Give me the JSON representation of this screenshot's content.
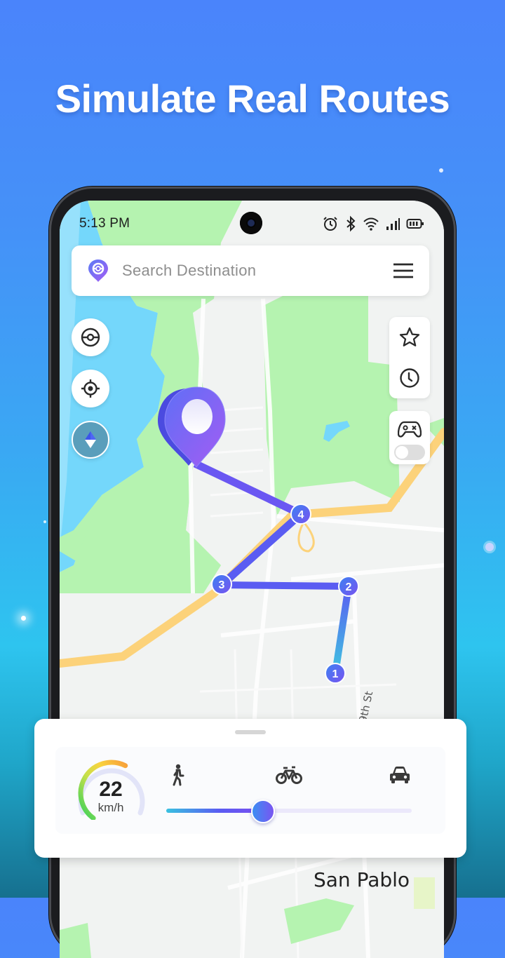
{
  "headline": "Simulate Real Routes",
  "status_bar": {
    "time": "5:13 PM",
    "icons": [
      "alarm-icon",
      "bluetooth-icon",
      "wifi-icon",
      "signal-icon",
      "battery-icon"
    ]
  },
  "search": {
    "placeholder": "Search Destination",
    "leading_icon": "location-pin-icon",
    "menu_icon": "hamburger-menu-icon"
  },
  "left_controls": [
    {
      "name": "pokeball-button",
      "icon": "pokeball-icon"
    },
    {
      "name": "my-location-button",
      "icon": "crosshair-icon"
    },
    {
      "name": "compass-button",
      "icon": "compass-icon"
    }
  ],
  "right_controls": {
    "favorites_icon": "star-icon",
    "history_icon": "clock-icon",
    "joystick_icon": "gamepad-icon",
    "joystick_enabled": false
  },
  "route": {
    "waypoints": [
      "1",
      "2",
      "3",
      "4"
    ],
    "destination_icon": "destination-pin-icon"
  },
  "map_labels": {
    "street": "9th St",
    "city": "San Pablo"
  },
  "speed_panel": {
    "speed_value": "22",
    "speed_unit": "km/h",
    "modes": [
      {
        "name": "walk",
        "icon": "walking-icon"
      },
      {
        "name": "bike",
        "icon": "bicycle-icon"
      },
      {
        "name": "car",
        "icon": "car-icon"
      }
    ],
    "slider_fraction": 0.39
  },
  "colors": {
    "accent": "#5a5cf2",
    "accent_purple": "#9b59f5",
    "route_cyan": "#3fc6e0",
    "highway": "#fcd27a",
    "park": "#b5f3b0",
    "water": "#74d7fb"
  }
}
